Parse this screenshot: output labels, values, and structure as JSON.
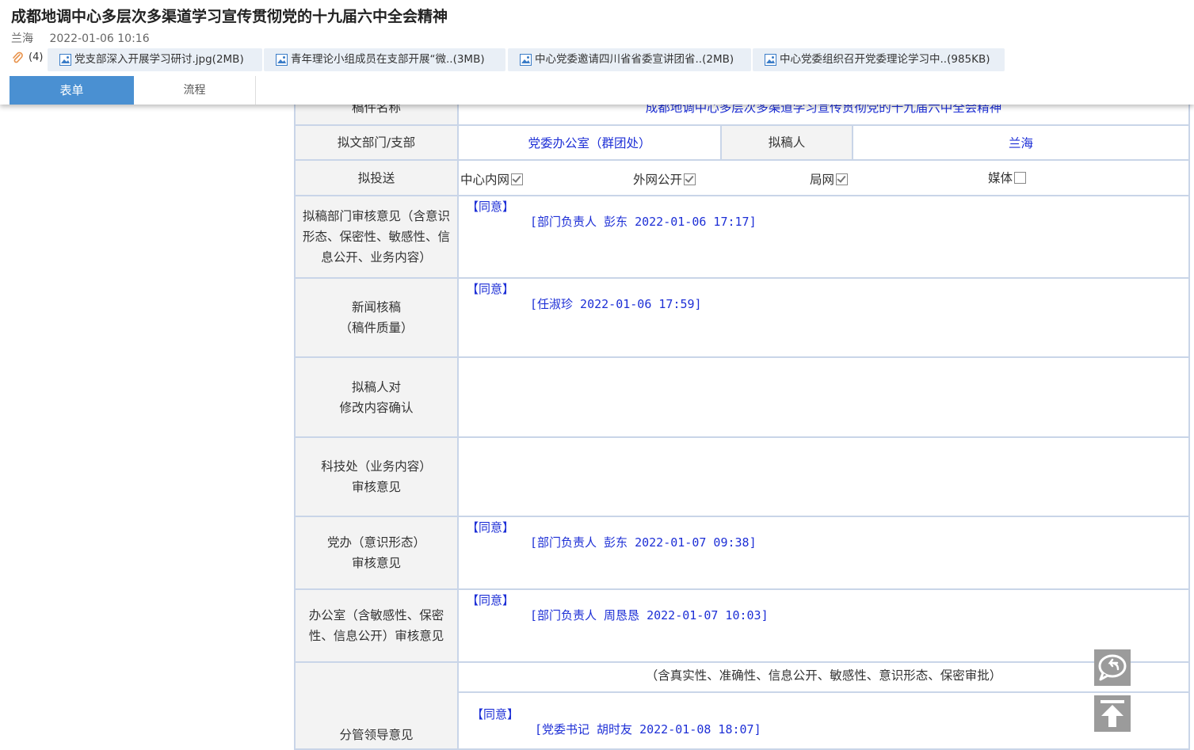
{
  "header": {
    "title": "成都地调中心多层次多渠道学习宣传贯彻党的十九届六中全会精神",
    "author": "兰海",
    "datetime": "2022-01-06 10:16",
    "attachment_count": "(4)",
    "attachments": [
      {
        "name": "党支部深入开展学习研讨.jpg(2MB)"
      },
      {
        "name": "青年理论小组成员在支部开展“微..(3MB)"
      },
      {
        "name": "中心党委邀请四川省省委宣讲团省..(2MB)"
      },
      {
        "name": "中心党委组织召开党委理论学习中..(985KB)"
      }
    ],
    "tabs": {
      "form": "表单",
      "flow": "流程"
    }
  },
  "form": {
    "row_title": {
      "label": "稿件名称",
      "value": "成都地调中心多层次多渠道学习宣传贯彻党的十九届六中全会精神"
    },
    "row_dept": {
      "label": "拟文部门/支部",
      "value": "党委办公室（群团处）",
      "drafter_label": "拟稿人",
      "drafter": "兰海"
    },
    "row_send": {
      "label": "拟投送",
      "options": [
        {
          "label": "中心内网",
          "checked": true
        },
        {
          "label": "外网公开",
          "checked": true
        },
        {
          "label": "局网",
          "checked": true
        },
        {
          "label": "媒体",
          "checked": false
        }
      ]
    },
    "row_dept_review": {
      "label": "拟稿部门审核意见（含意识形态、保密性、敏感性、信息公开、业务内容）",
      "opinion": "【同意】",
      "sign": "[部门负责人 彭东 2022-01-06 17:17]"
    },
    "row_news": {
      "label1": "新闻核稿",
      "label2": "（稿件质量）",
      "opinion": "【同意】",
      "sign": "[任淑珍 2022-01-06 17:59]"
    },
    "row_confirm": {
      "label1": "拟稿人对",
      "label2": "修改内容确认"
    },
    "row_tech": {
      "label1": "科技处（业务内容）",
      "label2": "审核意见"
    },
    "row_party": {
      "label1": "党办（意识形态）",
      "label2": "审核意见",
      "opinion": "【同意】",
      "sign": "[部门负责人 彭东 2022-01-07 09:38]"
    },
    "row_office": {
      "label1": "办公室（含敏感性、保密",
      "label2": "性、信息公开）审核意见",
      "opinion": "【同意】",
      "sign": "[部门负责人 周恳恳 2022-01-07 10:03]"
    },
    "row_leader": {
      "label": "分管领导意见",
      "note": "（含真实性、准确性、信息公开、敏感性、意识形态、保密审批）",
      "opinion": "【同意】",
      "sign": "[党委书记 胡时友 2022-01-08 18:07]"
    }
  },
  "icons": {
    "reply": "reply-bubble-icon",
    "top": "back-to-top-icon"
  }
}
